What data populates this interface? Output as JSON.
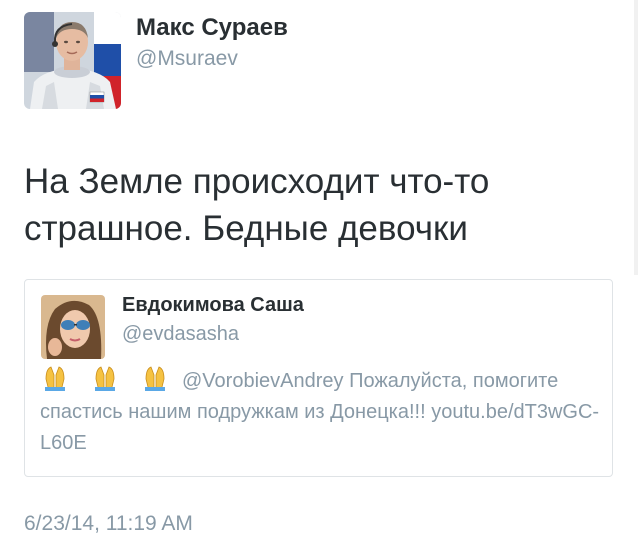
{
  "tweet": {
    "author_name": "Макс Сураев",
    "author_handle": "@Msuraev",
    "text": "На Земле происходит что-то страшное. Бедные девочки",
    "timestamp": "6/23/14, 11:19 AM"
  },
  "quoted_tweet": {
    "author_name": "Евдокимова Саша",
    "author_handle": "@evdasasha",
    "emoji": [
      "folded-hands",
      "folded-hands",
      "folded-hands"
    ],
    "mention": "@VorobievAndrey",
    "text": "Пожалуйста, помогите спастись нашим подружкам из Донецка!!!",
    "link": "youtu.be/dT3wGC-L60E"
  },
  "colors": {
    "text_primary": "#292f33",
    "text_secondary": "#8899a6",
    "card_border": "#dfe3e6"
  }
}
